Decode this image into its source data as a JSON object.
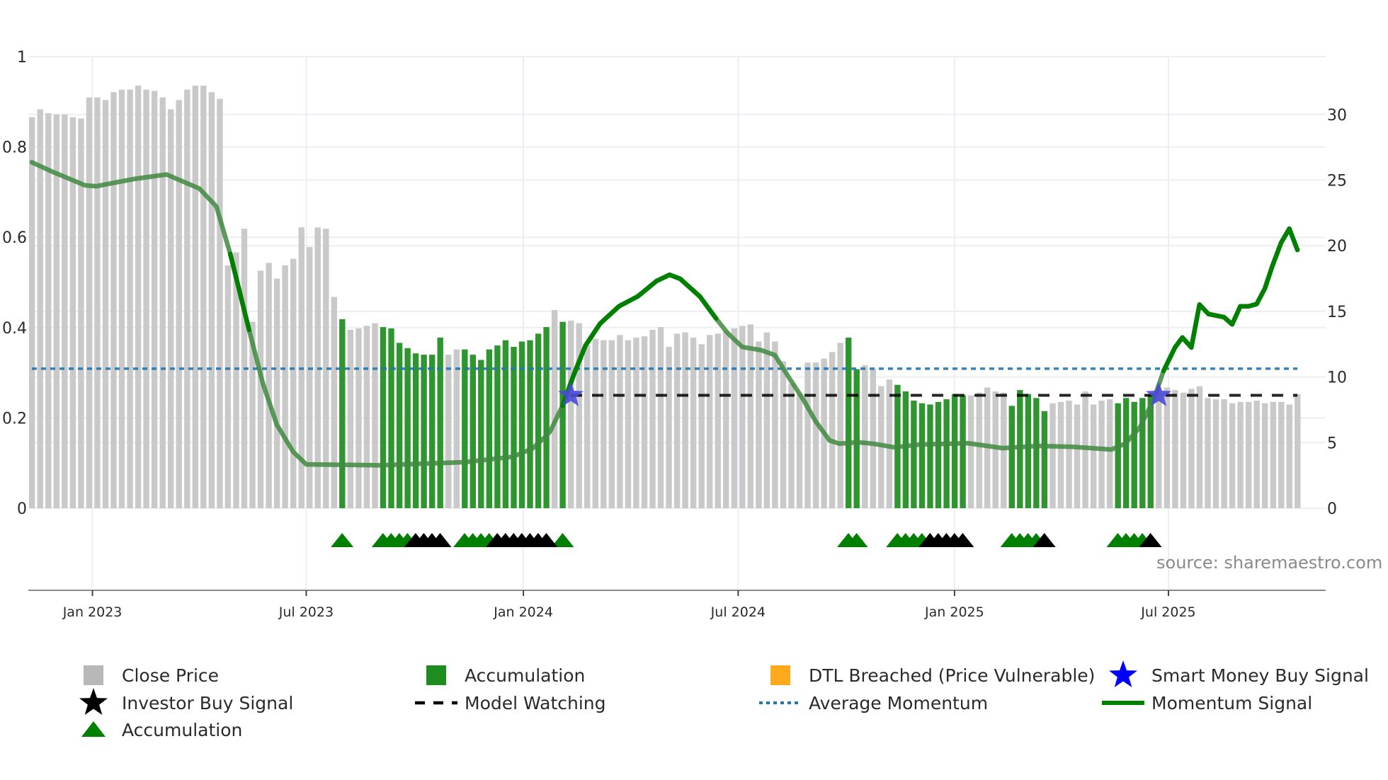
{
  "chart_data": {
    "type": "bar",
    "title": "",
    "source_note": "source: sharemaestro.com",
    "x_unit": "week index (weekly bars, Nov 2022 – Nov 2025)",
    "x_ticks": [
      {
        "label": "Jan 2023",
        "x": 8.42
      },
      {
        "label": "Jul 2023",
        "x": 34.6
      },
      {
        "label": "Jan 2024",
        "x": 61.2
      },
      {
        "label": "Jul 2024",
        "x": 87.5
      },
      {
        "label": "Jan 2025",
        "x": 114.0
      },
      {
        "label": "Jul 2025",
        "x": 140.2
      }
    ],
    "left_axis": {
      "range": [
        0,
        1
      ],
      "ticks": [
        "0",
        "0.2",
        "0.4",
        "0.6",
        "0.8",
        "1"
      ],
      "tick_values": [
        0,
        0.2,
        0.4,
        0.6,
        0.8,
        1
      ]
    },
    "right_axis": {
      "range": [
        0,
        34.4
      ],
      "ticks": [
        "0",
        "5",
        "10",
        "15",
        "20",
        "25",
        "30"
      ],
      "tick_values": [
        0,
        5,
        10,
        15,
        20,
        25,
        30
      ]
    },
    "close_price": [
      29.8,
      30.4,
      30.1,
      30.0,
      30.0,
      29.8,
      29.7,
      31.3,
      31.3,
      31.1,
      31.7,
      31.9,
      31.9,
      32.2,
      31.9,
      31.8,
      31.3,
      30.4,
      31.1,
      31.9,
      32.2,
      32.2,
      31.7,
      31.2,
      18.5,
      19.5,
      21.3,
      14.2,
      18.1,
      18.7,
      17.5,
      18.5,
      19.0,
      21.4,
      19.9,
      21.4,
      21.3,
      16.1,
      14.4,
      13.6,
      13.7,
      13.9,
      14.1,
      13.8,
      13.7,
      12.6,
      12.2,
      11.8,
      11.7,
      11.7,
      13.0,
      11.7,
      12.1,
      12.1,
      11.7,
      11.3,
      12.1,
      12.4,
      12.8,
      12.3,
      12.7,
      12.8,
      13.3,
      13.8,
      15.1,
      14.2,
      14.3,
      14.1,
      12.4,
      12.9,
      12.8,
      12.8,
      13.2,
      12.8,
      13.0,
      13.1,
      13.6,
      13.8,
      12.3,
      13.3,
      13.4,
      13.0,
      12.5,
      13.2,
      13.3,
      13.5,
      13.7,
      13.9,
      14.0,
      12.7,
      13.4,
      12.7,
      11.2,
      9.5,
      8.7,
      11.1,
      11.1,
      11.4,
      11.9,
      12.6,
      13.0,
      10.6,
      10.9,
      10.6,
      9.3,
      9.8,
      9.4,
      8.9,
      8.2,
      8.0,
      7.9,
      8.1,
      8.3,
      8.7,
      8.6,
      8.6,
      8.8,
      9.2,
      8.9,
      8.8,
      7.8,
      9.0,
      8.7,
      8.4,
      7.4,
      8.0,
      8.1,
      8.2,
      7.9,
      8.9,
      7.9,
      8.2,
      8.3,
      8.0,
      8.4,
      8.1,
      8.4,
      8.7,
      9.2,
      9.2,
      9.0,
      8.8,
      9.1,
      9.3,
      8.4,
      8.3,
      8.3,
      8.0,
      8.1,
      8.1,
      8.2,
      8.0,
      8.1,
      8.1,
      7.9,
      8.7
    ],
    "accumulation_weeks": [
      39,
      44,
      45,
      46,
      47,
      48,
      49,
      50,
      51,
      54,
      55,
      56,
      57,
      58,
      59,
      60,
      61,
      62,
      63,
      64,
      66,
      101,
      102,
      107,
      108,
      109,
      110,
      111,
      112,
      113,
      114,
      115,
      121,
      122,
      123,
      124,
      125,
      134,
      135,
      136,
      137,
      138
    ],
    "accumulation_markers": [
      39,
      44,
      45,
      46,
      47,
      54,
      55,
      56,
      57,
      66,
      101,
      102,
      107,
      108,
      109,
      110,
      121,
      122,
      123,
      124,
      134,
      135,
      136,
      137
    ],
    "investor_buy_markers": [
      48,
      49,
      50,
      51,
      58,
      59,
      60,
      61,
      62,
      63,
      64,
      111,
      112,
      113,
      114,
      115,
      125,
      138
    ],
    "smart_money_buy": [
      {
        "x": 67,
        "y": 0.25
      },
      {
        "x": 139,
        "y": 0.25
      }
    ],
    "average_momentum": 0.309,
    "model_watching": {
      "value": 0.25,
      "from": 67,
      "to": 156
    },
    "momentum_signal": [
      [
        1,
        0.766
      ],
      [
        3.4,
        0.746
      ],
      [
        7.5,
        0.715
      ],
      [
        8.9,
        0.713
      ],
      [
        13.5,
        0.729
      ],
      [
        17.5,
        0.739
      ],
      [
        21.5,
        0.708
      ],
      [
        23.6,
        0.668
      ],
      [
        25.3,
        0.563
      ],
      [
        27.6,
        0.395
      ],
      [
        29.3,
        0.276
      ],
      [
        31,
        0.185
      ],
      [
        33,
        0.125
      ],
      [
        34.6,
        0.097
      ],
      [
        39.6,
        0.096
      ],
      [
        43.6,
        0.095
      ],
      [
        54.1,
        0.102
      ],
      [
        59.9,
        0.114
      ],
      [
        62.3,
        0.132
      ],
      [
        64,
        0.16
      ],
      [
        64.5,
        0.171
      ],
      [
        66,
        0.227
      ],
      [
        67.4,
        0.297
      ],
      [
        68.8,
        0.36
      ],
      [
        70.6,
        0.409
      ],
      [
        72.9,
        0.447
      ],
      [
        75.2,
        0.469
      ],
      [
        77.5,
        0.503
      ],
      [
        79.1,
        0.517
      ],
      [
        80.4,
        0.508
      ],
      [
        82.8,
        0.469
      ],
      [
        84.8,
        0.42
      ],
      [
        86.2,
        0.388
      ],
      [
        88,
        0.357
      ],
      [
        90.3,
        0.35
      ],
      [
        92,
        0.339
      ],
      [
        93.8,
        0.287
      ],
      [
        95.5,
        0.24
      ],
      [
        97,
        0.192
      ],
      [
        98.7,
        0.15
      ],
      [
        99.9,
        0.143
      ],
      [
        102.2,
        0.146
      ],
      [
        104,
        0.143
      ],
      [
        106.6,
        0.135
      ],
      [
        109.8,
        0.141
      ],
      [
        115.6,
        0.144
      ],
      [
        119.9,
        0.133
      ],
      [
        124.3,
        0.138
      ],
      [
        128.4,
        0.136
      ],
      [
        133.2,
        0.13
      ],
      [
        134.9,
        0.143
      ],
      [
        136.7,
        0.179
      ],
      [
        138.4,
        0.241
      ],
      [
        139.6,
        0.304
      ],
      [
        141,
        0.356
      ],
      [
        141.9,
        0.378
      ],
      [
        143,
        0.356
      ],
      [
        144,
        0.451
      ],
      [
        145.1,
        0.43
      ],
      [
        147,
        0.423
      ],
      [
        148,
        0.407
      ],
      [
        149,
        0.447
      ],
      [
        150,
        0.447
      ],
      [
        151,
        0.452
      ],
      [
        152,
        0.486
      ],
      [
        152.9,
        0.535
      ],
      [
        154,
        0.588
      ],
      [
        155,
        0.619
      ],
      [
        156,
        0.572
      ]
    ],
    "momentum_strong_ranges": [
      [
        25,
        28
      ],
      [
        66,
        86
      ],
      [
        139,
        156
      ]
    ],
    "legend_position": "bottom",
    "legend": [
      {
        "label": "Close Price",
        "symbol": "square",
        "color": "#b8b8b8"
      },
      {
        "label": "Accumulation",
        "symbol": "square",
        "color": "#1f8c1f"
      },
      {
        "label": "DTL Breached (Price Vulnerable)",
        "symbol": "square",
        "color": "#ffaa1c"
      },
      {
        "label": "Smart Money Buy Signal",
        "symbol": "star",
        "color": "#0000ff"
      },
      {
        "label": "Investor Buy Signal",
        "symbol": "star",
        "color": "#000000"
      },
      {
        "label": "Model Watching",
        "symbol": "dash",
        "color": "#000000"
      },
      {
        "label": "Average Momentum",
        "symbol": "dot",
        "color": "#1f77b4"
      },
      {
        "label": "Momentum Signal",
        "symbol": "line",
        "color": "#008000"
      },
      {
        "label": "Accumulation",
        "symbol": "triangle",
        "color": "#008000"
      }
    ],
    "colors": {
      "close": "#c9c9c9",
      "accumulation": "#2f962f",
      "momentum": "#008000",
      "momentum_faded": "#3f8a3f",
      "average": "#1f77b4",
      "watching": "#000000",
      "smart_money": "#4a4ad6",
      "grid": "#eceef3",
      "axis": "#8a8a8a"
    }
  }
}
